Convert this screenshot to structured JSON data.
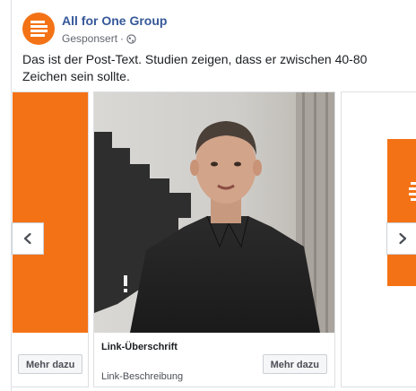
{
  "post": {
    "page_name": "All for One Group",
    "sponsored_label": "Gesponsert",
    "separator": "·",
    "text": "Das ist der Post-Text. Studien zeigen, dass er zwischen 40-80 Zeichen sein sollte."
  },
  "carousel": {
    "cards": [
      {
        "cta_label": "Mehr dazu"
      },
      {
        "headline": "Link-Überschrift",
        "description": "Link-Beschreibung",
        "cta_label": "Mehr dazu"
      },
      {}
    ]
  },
  "colors": {
    "brand_orange": "#f47216",
    "link_blue": "#365899"
  },
  "icons": {
    "avatar": "all-for-one-logo-icon",
    "privacy": "globe-icon",
    "prev": "chevron-left-icon",
    "next": "chevron-right-icon"
  }
}
